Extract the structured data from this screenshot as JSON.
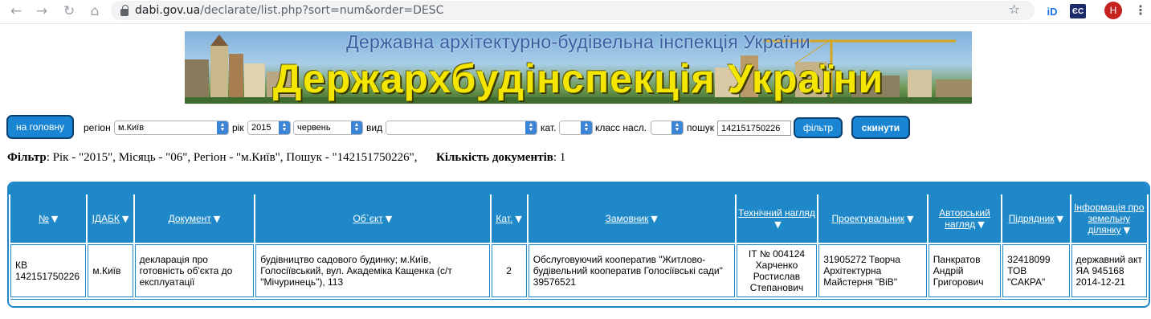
{
  "browser": {
    "url_host": "dabi.gov.ua",
    "url_path": "/declarate/list.php?sort=num&order=DESC",
    "profile_initial": "H",
    "ext_id_label": "iD",
    "ext_flag_label": "ЄС"
  },
  "banner": {
    "subtitle": "Державна архітектурно-будівельна інспекція України",
    "title": "Держархбудінспекція України"
  },
  "filter_form": {
    "home_button": "на головну",
    "region_label": "регіон",
    "region_value": "м.Київ",
    "year_label": "рік",
    "year_value": "2015",
    "month_value": "червень",
    "type_label": "вид",
    "type_value": "",
    "cat_label": "кат.",
    "cat_value": "",
    "class_label": "класс насл.",
    "class_value": "",
    "search_label": "пошук",
    "search_value": "142151750226",
    "filter_button": "фільтр",
    "reset_button": "скинути"
  },
  "summary": {
    "filter_label": "Фільтр",
    "filter_text": ": Рік - \"2015\", Місяць - \"06\", Регіон - \"м.Київ\", Пошук - \"142151750226\",",
    "count_label": "Кількість документів",
    "count_text": ": 1"
  },
  "table": {
    "headers": [
      "№",
      "ІДАБК",
      "Документ",
      "Об`єкт",
      "Кат.",
      "Замовник",
      "Технічний нагляд",
      "Проектувальник",
      "Авторський нагляд",
      "Підрядник",
      "Інформація про земельну ділянку"
    ],
    "rows": [
      {
        "num": "КВ 142151750226",
        "idabk": "м.Київ",
        "document": "декларація про готовність об'єкта до експлуатації",
        "object": "будівництво садового будинку; м.Київ, Голосіївський, вул. Академіка Кащенка (с/т \"Мічуринець\"), 113",
        "cat": "2",
        "customer": "Обслуговуючий кооператив \"Житлово-будівельний кооператив Голосіївські сади\" 39576521",
        "tech": "ІТ № 004124 Харченко Ростислав Степанович",
        "designer": "31905272 Творча Архітектурна Майстерня \"ВіВ\"",
        "author": "Панкратов Андрій Григорович",
        "contractor": "32418099 ТОВ \"САКРА\"",
        "land": "державний акт ЯА 945168 2014-12-21"
      }
    ]
  },
  "colors": {
    "accent": "#1e88c9",
    "button": "#1a86d3",
    "banner_title": "#f4e600"
  },
  "icons": [
    "back-arrow-icon",
    "forward-arrow-icon",
    "reload-icon",
    "home-icon",
    "lock-icon",
    "star-icon",
    "menu-kebab-icon",
    "sort-triangle-icon"
  ]
}
